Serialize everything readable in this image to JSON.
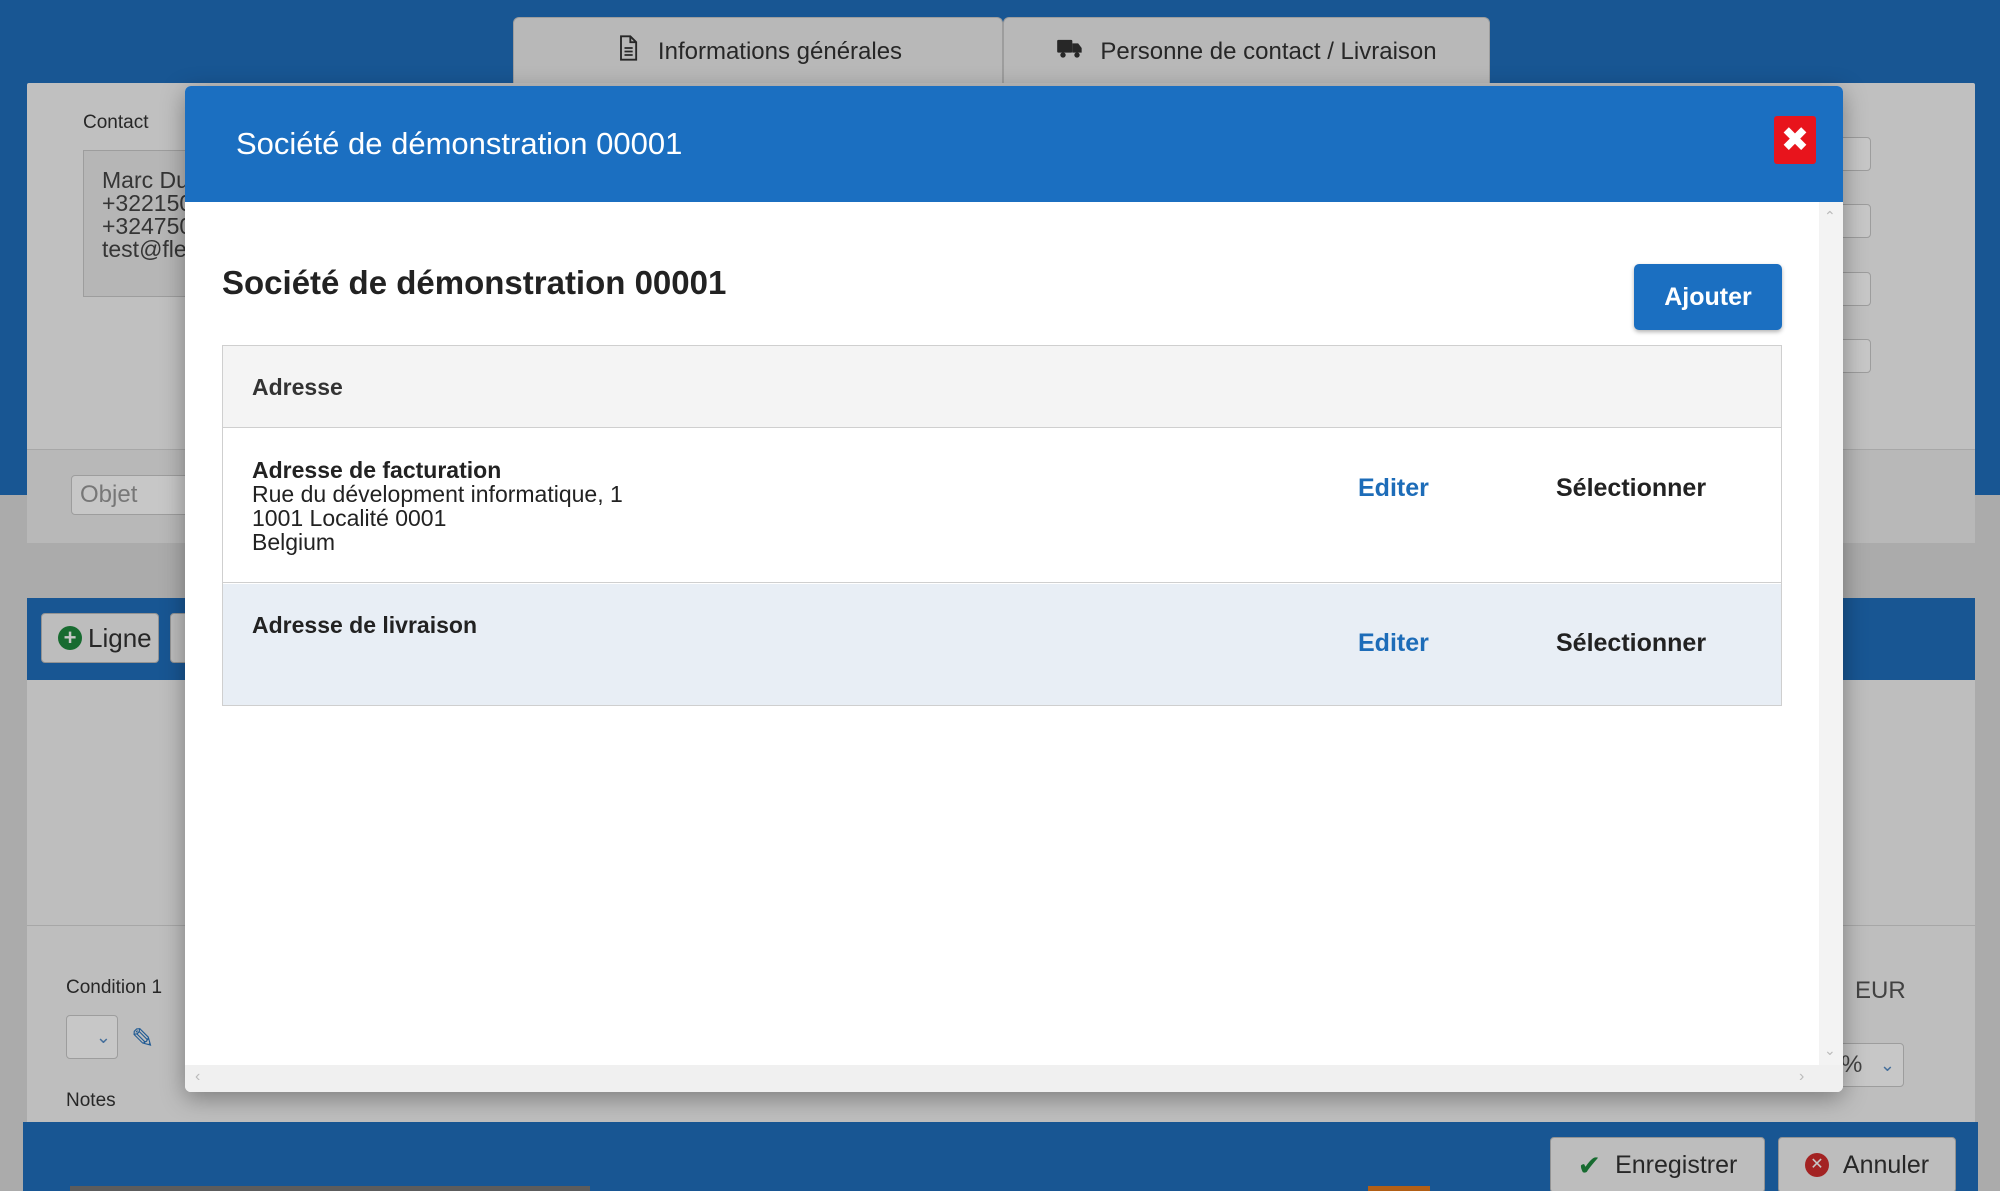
{
  "tabs": [
    {
      "label": "Informations générales",
      "icon": "document-icon"
    },
    {
      "label": "Personne de contact / Livraison",
      "icon": "truck-icon"
    }
  ],
  "background": {
    "contact_label": "Contact",
    "contact_lines": [
      "Marc Du",
      "+322150",
      "+324750",
      "test@fle"
    ],
    "objet_placeholder": "Objet",
    "ligne_button": "Ligne",
    "condition_label": "Condition 1",
    "notes_label": "Notes",
    "currency": "EUR",
    "percent_value": "%",
    "save_button": "Enregistrer",
    "cancel_button": "Annuler"
  },
  "modal": {
    "header_title": "Société de démonstration 00001",
    "close_icon": "close-icon",
    "section_title": "Société de démonstration 00001",
    "add_button": "Ajouter",
    "table": {
      "header": "Adresse",
      "rows": [
        {
          "name": "Adresse de facturation",
          "lines": [
            "Rue du dévelopment informatique, 1",
            "1001 Localité 0001",
            "Belgium"
          ],
          "edit": "Editer",
          "select": "Sélectionner"
        },
        {
          "name": "Adresse de livraison",
          "lines": [],
          "edit": "Editer",
          "select": "Sélectionner"
        }
      ]
    }
  },
  "colors": {
    "brand_blue": "#1b6fc1",
    "close_red": "#e8141c",
    "link_blue": "#1d6cb8",
    "selected_row": "#e8eef5"
  }
}
